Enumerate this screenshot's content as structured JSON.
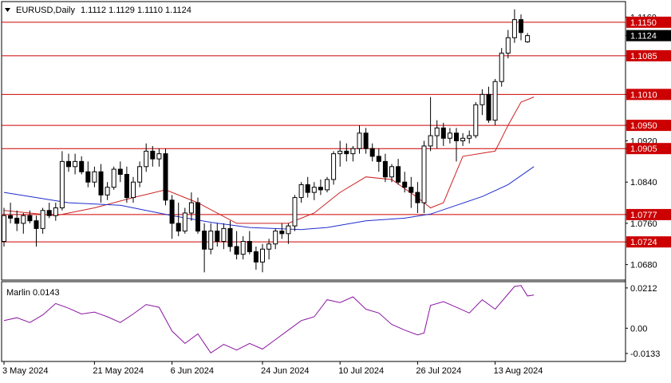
{
  "header": {
    "symbol": "EURUSD,Daily",
    "ohlc": "1.1112 1.1129 1.1110 1.1124",
    "menu_icon": "triangle-down-icon"
  },
  "indicator": {
    "title": "Marlin 0.0143"
  },
  "chart_data": [
    {
      "type": "candlestick",
      "title": "EURUSD,Daily",
      "ylim": [
        1.065,
        1.119
      ],
      "price_ticks": [
        "1.1160",
        "1.1124",
        "1.1085",
        "1.1010",
        "1.0950",
        "1.0920",
        "1.0905",
        "1.0840",
        "1.0777",
        "1.0760",
        "1.0724",
        "1.0680"
      ],
      "last_price": "1.1124",
      "levels": [
        {
          "value": 1.115,
          "label": "1.1150",
          "color": "#cc0000"
        },
        {
          "value": 1.1085,
          "label": "1.1085",
          "color": "#cc0000"
        },
        {
          "value": 1.101,
          "label": "1.1010",
          "color": "#cc0000"
        },
        {
          "value": 1.095,
          "label": "1.0950",
          "color": "#cc0000"
        },
        {
          "value": 1.0905,
          "label": "1.0905",
          "color": "#cc0000"
        },
        {
          "value": 1.0777,
          "label": "1.0777",
          "color": "#cc0000"
        },
        {
          "value": 1.0724,
          "label": "1.0724",
          "color": "#cc0000"
        }
      ],
      "date_labels": [
        "3 May 2024",
        "21 May 2024",
        "6 Jun 2024",
        "24 Jun 2024",
        "10 Jul 2024",
        "26 Jul 2024",
        "13 Aug 2024"
      ],
      "date_label_index": [
        0,
        14,
        26,
        40,
        52,
        64,
        76
      ],
      "candles": [
        [
          1.0725,
          1.079,
          1.0715,
          1.0775
        ],
        [
          1.0775,
          1.08,
          1.076,
          1.077
        ],
        [
          1.077,
          1.0785,
          1.0745,
          1.076
        ],
        [
          1.076,
          1.078,
          1.074,
          1.0775
        ],
        [
          1.0775,
          1.0785,
          1.076,
          1.0765
        ],
        [
          1.0765,
          1.0775,
          1.0715,
          1.075
        ],
        [
          1.075,
          1.079,
          1.074,
          1.0785
        ],
        [
          1.0785,
          1.08,
          1.077,
          1.0775
        ],
        [
          1.0775,
          1.08,
          1.0765,
          1.079
        ],
        [
          1.079,
          1.09,
          1.0785,
          1.088
        ],
        [
          1.088,
          1.0895,
          1.086,
          1.087
        ],
        [
          1.087,
          1.0895,
          1.0855,
          1.088
        ],
        [
          1.088,
          1.089,
          1.0855,
          1.086
        ],
        [
          1.086,
          1.088,
          1.083,
          1.084
        ],
        [
          1.084,
          1.087,
          1.083,
          1.086
        ],
        [
          1.086,
          1.0875,
          1.08,
          1.0815
        ],
        [
          1.0815,
          1.084,
          1.0805,
          1.083
        ],
        [
          1.083,
          1.087,
          1.0825,
          1.0865
        ],
        [
          1.0865,
          1.088,
          1.084,
          1.0855
        ],
        [
          1.0855,
          1.087,
          1.08,
          1.081
        ],
        [
          1.081,
          1.085,
          1.08,
          1.084
        ],
        [
          1.084,
          1.088,
          1.083,
          1.087
        ],
        [
          1.087,
          1.0915,
          1.086,
          1.09
        ],
        [
          1.09,
          1.091,
          1.087,
          1.0885
        ],
        [
          1.0885,
          1.0905,
          1.087,
          1.0895
        ],
        [
          1.0895,
          1.0905,
          1.0795,
          1.0805
        ],
        [
          1.0805,
          1.0815,
          1.073,
          1.076
        ],
        [
          1.076,
          1.08,
          1.0735,
          1.0745
        ],
        [
          1.0745,
          1.079,
          1.074,
          1.078
        ],
        [
          1.078,
          1.082,
          1.0765,
          1.08
        ],
        [
          1.08,
          1.081,
          1.074,
          1.0745
        ],
        [
          1.0745,
          1.076,
          1.0665,
          1.071
        ],
        [
          1.071,
          1.076,
          1.07,
          1.0745
        ],
        [
          1.0745,
          1.076,
          1.0715,
          1.0725
        ],
        [
          1.0725,
          1.076,
          1.071,
          1.075
        ],
        [
          1.075,
          1.0765,
          1.0705,
          1.0715
        ],
        [
          1.0715,
          1.0745,
          1.069,
          1.07
        ],
        [
          1.07,
          1.0735,
          1.069,
          1.0725
        ],
        [
          1.0725,
          1.0745,
          1.07,
          1.0705
        ],
        [
          1.0705,
          1.0715,
          1.067,
          1.0685
        ],
        [
          1.0685,
          1.072,
          1.0665,
          1.071
        ],
        [
          1.071,
          1.073,
          1.069,
          1.072
        ],
        [
          1.072,
          1.075,
          1.071,
          1.0745
        ],
        [
          1.0745,
          1.076,
          1.073,
          1.074
        ],
        [
          1.074,
          1.076,
          1.072,
          1.0755
        ],
        [
          1.0755,
          1.0815,
          1.0745,
          1.081
        ],
        [
          1.081,
          1.084,
          1.08,
          1.0835
        ],
        [
          1.0835,
          1.085,
          1.081,
          1.082
        ],
        [
          1.082,
          1.084,
          1.0805,
          1.083
        ],
        [
          1.083,
          1.0845,
          1.0815,
          1.0825
        ],
        [
          1.0825,
          1.085,
          1.082,
          1.0845
        ],
        [
          1.0845,
          1.09,
          1.0835,
          1.0895
        ],
        [
          1.0895,
          1.092,
          1.087,
          1.09
        ],
        [
          1.09,
          1.0915,
          1.088,
          1.0895
        ],
        [
          1.0895,
          1.091,
          1.088,
          1.0905
        ],
        [
          1.0905,
          1.095,
          1.0895,
          1.0935
        ],
        [
          1.0935,
          1.0945,
          1.0895,
          1.0905
        ],
        [
          1.0905,
          1.0915,
          1.088,
          1.089
        ],
        [
          1.089,
          1.0905,
          1.086,
          1.088
        ],
        [
          1.088,
          1.0895,
          1.084,
          1.085
        ],
        [
          1.085,
          1.0875,
          1.084,
          1.087
        ],
        [
          1.087,
          1.0885,
          1.0835,
          1.084
        ],
        [
          1.084,
          1.086,
          1.082,
          1.083
        ],
        [
          1.083,
          1.085,
          1.079,
          1.082
        ],
        [
          1.082,
          1.084,
          1.078,
          1.08
        ],
        [
          1.08,
          1.092,
          1.078,
          1.091
        ],
        [
          1.091,
          1.1005,
          1.09,
          1.093
        ],
        [
          1.093,
          1.096,
          1.0905,
          1.0945
        ],
        [
          1.0945,
          1.0955,
          1.091,
          1.0925
        ],
        [
          1.0925,
          1.0945,
          1.0915,
          1.0935
        ],
        [
          1.0935,
          1.0945,
          1.088,
          1.092
        ],
        [
          1.092,
          1.0935,
          1.091,
          1.0925
        ],
        [
          1.0925,
          1.094,
          1.0915,
          1.093
        ],
        [
          1.093,
          1.0995,
          1.0925,
          1.099
        ],
        [
          1.099,
          1.102,
          1.097,
          1.101
        ],
        [
          1.101,
          1.1025,
          1.0955,
          1.096
        ],
        [
          1.096,
          1.104,
          1.095,
          1.1035
        ],
        [
          1.1035,
          1.11,
          1.1025,
          1.109
        ],
        [
          1.109,
          1.1135,
          1.108,
          1.112
        ],
        [
          1.112,
          1.1175,
          1.111,
          1.1155
        ],
        [
          1.1155,
          1.1165,
          1.1115,
          1.113
        ],
        [
          1.1112,
          1.1129,
          1.111,
          1.1124
        ]
      ],
      "ma_fast": {
        "color": "#cc2222",
        "points": [
          [
            0,
            1.0785
          ],
          [
            8,
            1.0775
          ],
          [
            14,
            1.079
          ],
          [
            20,
            1.081
          ],
          [
            25,
            1.0825
          ],
          [
            30,
            1.08
          ],
          [
            36,
            1.076
          ],
          [
            44,
            1.076
          ],
          [
            48,
            1.078
          ],
          [
            52,
            1.082
          ],
          [
            56,
            1.085
          ],
          [
            60,
            1.0845
          ],
          [
            64,
            1.081
          ],
          [
            66,
            1.079
          ],
          [
            68,
            1.08
          ],
          [
            71,
            1.089
          ],
          [
            76,
            1.09
          ],
          [
            78,
            1.095
          ],
          [
            80,
            1.0995
          ],
          [
            82,
            1.1005
          ]
        ]
      },
      "ma_slow": {
        "color": "#1f2dcc",
        "points": [
          [
            0,
            1.082
          ],
          [
            10,
            1.08
          ],
          [
            18,
            1.0795
          ],
          [
            26,
            1.0775
          ],
          [
            32,
            1.0762
          ],
          [
            38,
            1.0752
          ],
          [
            46,
            1.0748
          ],
          [
            50,
            1.0752
          ],
          [
            56,
            1.0765
          ],
          [
            62,
            1.077
          ],
          [
            66,
            1.0778
          ],
          [
            70,
            1.0795
          ],
          [
            74,
            1.0812
          ],
          [
            78,
            1.0835
          ],
          [
            82,
            1.087
          ]
        ]
      }
    },
    {
      "type": "line",
      "title": "Marlin 0.0143",
      "ylim": [
        -0.0175,
        0.0245
      ],
      "ticks": [
        "0.0212",
        "0.00",
        "-0.0133"
      ],
      "color": "#8a16a0",
      "points": [
        [
          0,
          0.004
        ],
        [
          2,
          0.0055
        ],
        [
          4,
          0.003
        ],
        [
          6,
          0.007
        ],
        [
          8,
          0.013
        ],
        [
          10,
          0.0105
        ],
        [
          12,
          0.0075
        ],
        [
          14,
          0.0085
        ],
        [
          16,
          0.006
        ],
        [
          18,
          0.003
        ],
        [
          20,
          0.0075
        ],
        [
          22,
          0.0125
        ],
        [
          24,
          0.011
        ],
        [
          26,
          -0.0015
        ],
        [
          28,
          -0.008
        ],
        [
          30,
          -0.003
        ],
        [
          32,
          -0.013
        ],
        [
          34,
          -0.0085
        ],
        [
          36,
          -0.0115
        ],
        [
          38,
          -0.008
        ],
        [
          40,
          -0.011
        ],
        [
          42,
          -0.006
        ],
        [
          44,
          -0.001
        ],
        [
          46,
          0.004
        ],
        [
          48,
          0.006
        ],
        [
          50,
          0.015
        ],
        [
          52,
          0.0135
        ],
        [
          54,
          0.0165
        ],
        [
          56,
          0.01
        ],
        [
          58,
          0.008
        ],
        [
          60,
          0.002
        ],
        [
          62,
          -0.001
        ],
        [
          64,
          -0.0035
        ],
        [
          65,
          -0.0025
        ],
        [
          66,
          0.012
        ],
        [
          68,
          0.014
        ],
        [
          70,
          0.011
        ],
        [
          72,
          0.008
        ],
        [
          74,
          0.015
        ],
        [
          76,
          0.01
        ],
        [
          78,
          0.018
        ],
        [
          79,
          0.022
        ],
        [
          80,
          0.0225
        ],
        [
          81,
          0.017
        ],
        [
          82,
          0.0175
        ]
      ]
    }
  ]
}
